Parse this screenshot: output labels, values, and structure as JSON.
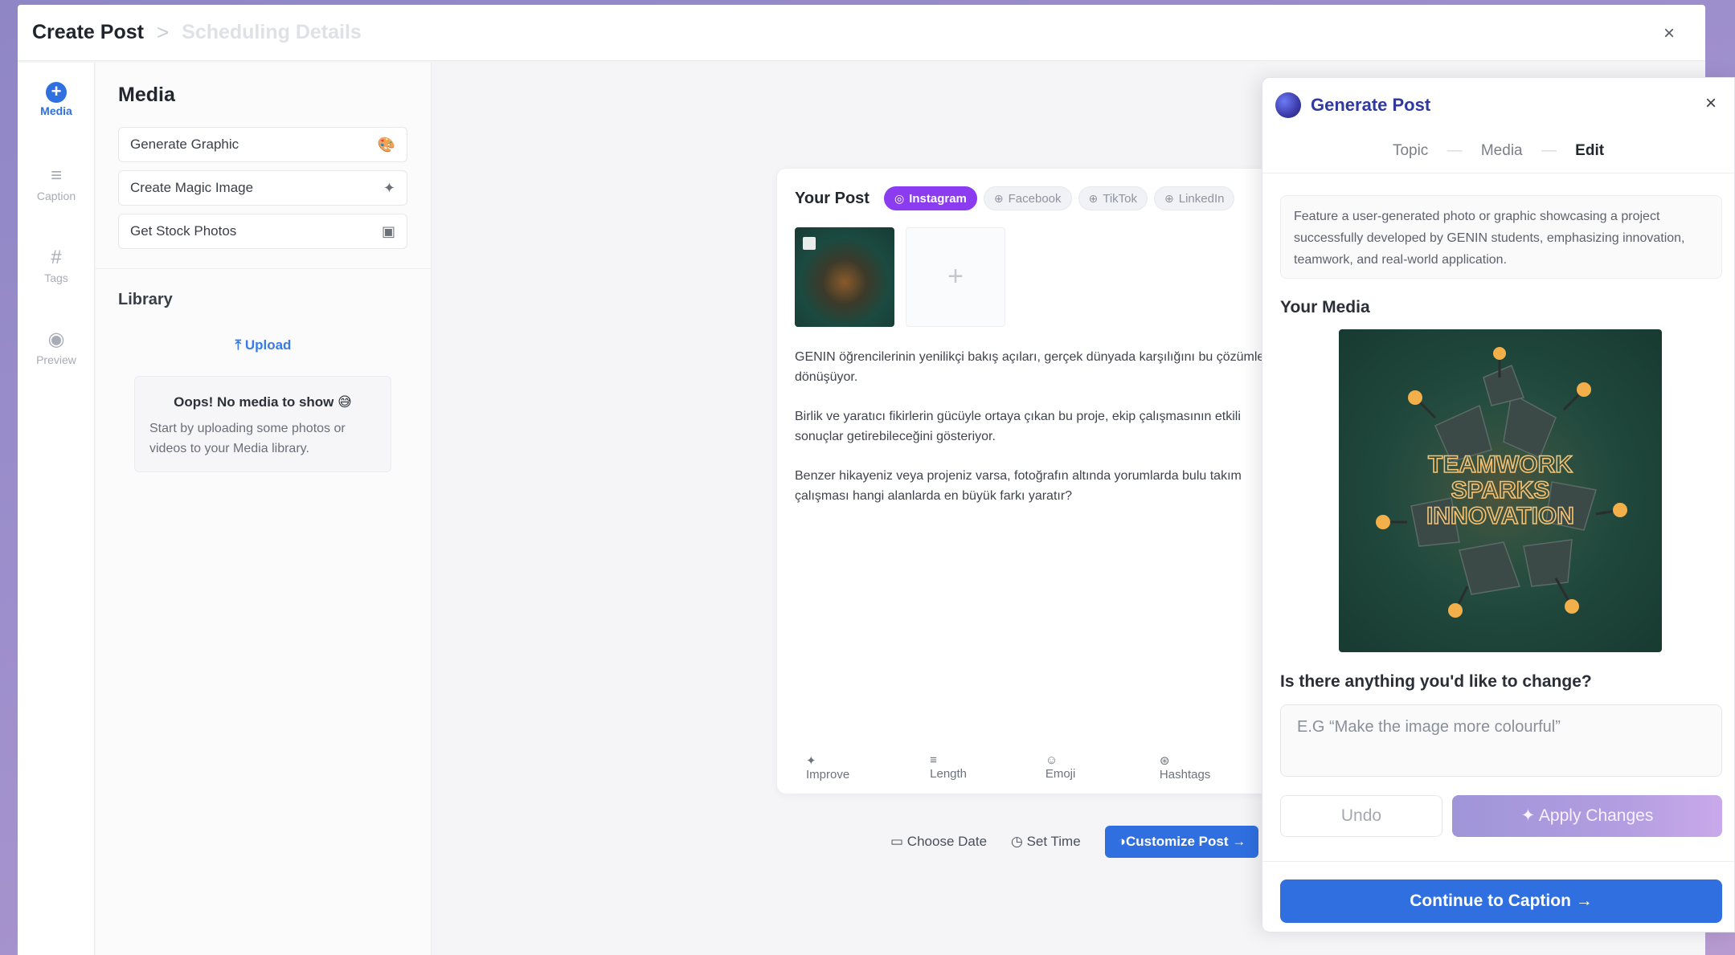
{
  "header": {
    "breadcrumb_current": "Create Post",
    "breadcrumb_separator": ">",
    "breadcrumb_next": "Scheduling Details",
    "close_label": "×"
  },
  "rail": {
    "items": [
      {
        "label": "Media",
        "icon": "plus-circle-icon",
        "glyph": "+"
      },
      {
        "label": "Caption",
        "icon": "caption-icon",
        "glyph": "≡"
      },
      {
        "label": "Tags",
        "icon": "hashtag-icon",
        "glyph": "#"
      },
      {
        "label": "Preview",
        "icon": "eye-icon",
        "glyph": "◉"
      }
    ]
  },
  "media_panel": {
    "title": "Media",
    "buttons": [
      {
        "label": "Generate Graphic",
        "icon": "palette-icon",
        "glyph": "🎨"
      },
      {
        "label": "Create Magic Image",
        "icon": "sparkle-icon",
        "glyph": "✦"
      },
      {
        "label": "Get Stock Photos",
        "icon": "images-icon",
        "glyph": "▣"
      }
    ],
    "library_title": "Library",
    "upload_label": "Upload",
    "empty_title": "Oops! No media to show 😅",
    "empty_text": "Start by uploading some photos or videos to your Media library."
  },
  "post": {
    "title": "Your Post",
    "tabs": [
      {
        "label": "Instagram",
        "icon": "instagram-icon"
      },
      {
        "label": "Facebook",
        "icon": "facebook-icon"
      },
      {
        "label": "TikTok",
        "icon": "tiktok-icon"
      },
      {
        "label": "LinkedIn",
        "icon": "linkedin-icon"
      }
    ],
    "add_label": "+",
    "paragraphs": [
      "GENIN öğrencilerinin yenilikçi bakış açıları, gerçek dünyada karşılığını bu çözümlere dönüşüyor.",
      "Birlik ve yaratıcı fikirlerin gücüyle ortaya çıkan bu proje, ekip çalışmasının etkili sonuçlar getirebileceğini gösteriyor.",
      "Benzer hikayeniz veya projeniz varsa, fotoğrafın altında yorumlarda bulu takım çalışması hangi alanlarda en büyük farkı yaratır?"
    ],
    "tools": [
      {
        "label": "Improve",
        "glyph": "✦"
      },
      {
        "label": "Length",
        "glyph": "≡"
      },
      {
        "label": "Emoji",
        "glyph": "☺"
      },
      {
        "label": "Hashtags",
        "glyph": "⊛"
      }
    ]
  },
  "schedule": {
    "choose_date": "Choose Date",
    "set_time": "Set Time",
    "customize": "Customize Post →"
  },
  "generate_panel": {
    "title": "Generate Post",
    "close_label": "×",
    "steps": [
      "Topic",
      "Media",
      "Edit"
    ],
    "active_step": "Edit",
    "topic_text": "Feature a user-generated photo or graphic showcasing a project successfully developed by GENIN students, emphasizing innovation, teamwork, and real-world application.",
    "your_media_label": "Your Media",
    "media_image_text": [
      "TEAMWORK",
      "SPARKS",
      "INNOVATION"
    ],
    "change_question": "Is there anything you'd like to change?",
    "change_placeholder": "E.G “Make the image more colourful”",
    "undo_label": "Undo",
    "apply_label": "Apply Changes",
    "continue_label": "Continue to Caption →"
  },
  "colors": {
    "accent": "#2f6fe0",
    "instagram": "#8b3cf0",
    "panel_title": "#2f3a9e",
    "neon": "#f3b04a"
  }
}
